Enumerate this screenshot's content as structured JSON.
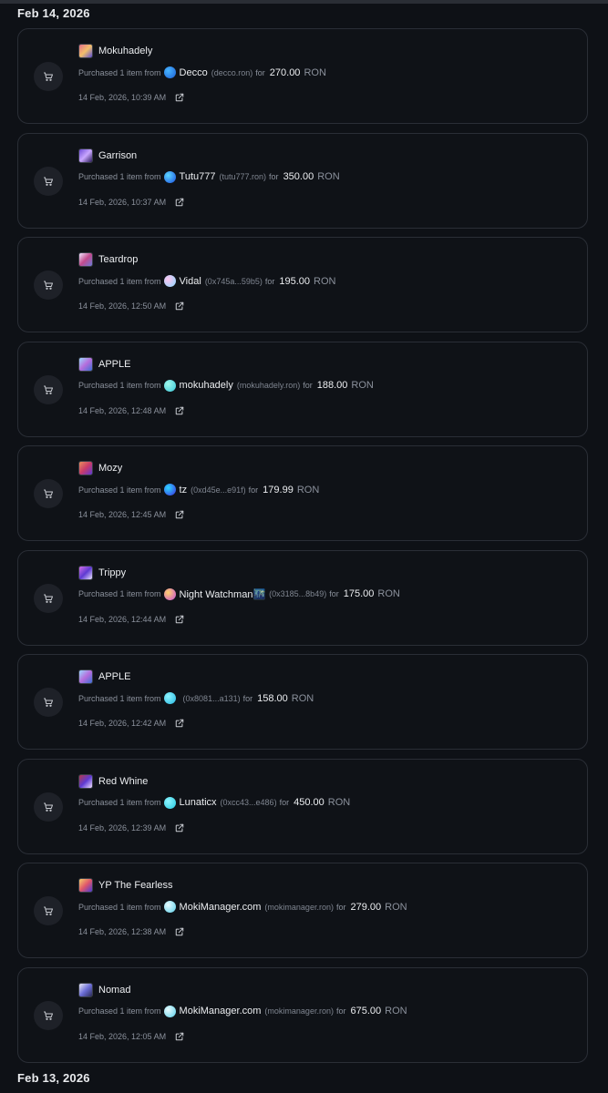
{
  "headers": {
    "first": "Feb 14, 2026",
    "second": "Feb 13, 2026"
  },
  "labels": {
    "purchased": "Purchased 1 item from",
    "for": "for"
  },
  "colors": {
    "background": "#0e1116",
    "card_border": "#2a2e36",
    "text": "#eceef1",
    "muted": "#8b919c"
  },
  "icons": {
    "action": "shopping-cart-icon",
    "link": "external-link-icon"
  },
  "items": [
    {
      "nft": "Mokuhadely",
      "seller": "Decco",
      "addr": "(decco.ron)",
      "price": "270.00",
      "currency": "RON",
      "time": "14 Feb, 2026, 10:39 AM"
    },
    {
      "nft": "Garrison",
      "seller": "Tutu777",
      "addr": "(tutu777.ron)",
      "price": "350.00",
      "currency": "RON",
      "time": "14 Feb, 2026, 10:37 AM"
    },
    {
      "nft": "Teardrop",
      "seller": "Vidal",
      "addr": "(0x745a...59b5)",
      "price": "195.00",
      "currency": "RON",
      "time": "14 Feb, 2026, 12:50 AM"
    },
    {
      "nft": "APPLE",
      "seller": "mokuhadely",
      "addr": "(mokuhadely.ron)",
      "price": "188.00",
      "currency": "RON",
      "time": "14 Feb, 2026, 12:48 AM"
    },
    {
      "nft": "Mozy",
      "seller": "tz",
      "addr": "(0xd45e...e91f)",
      "price": "179.99",
      "currency": "RON",
      "time": "14 Feb, 2026, 12:45 AM"
    },
    {
      "nft": "Trippy",
      "seller": "Night Watchman🌃",
      "addr": "(0x3185...8b49)",
      "price": "175.00",
      "currency": "RON",
      "time": "14 Feb, 2026, 12:44 AM"
    },
    {
      "nft": "APPLE",
      "seller": "",
      "addr": "(0x8081...a131)",
      "price": "158.00",
      "currency": "RON",
      "time": "14 Feb, 2026, 12:42 AM"
    },
    {
      "nft": "Red Whine",
      "seller": "Lunaticx",
      "addr": "(0xcc43...e486)",
      "price": "450.00",
      "currency": "RON",
      "time": "14 Feb, 2026, 12:39 AM"
    },
    {
      "nft": "YP The Fearless",
      "seller": "MokiManager.com",
      "addr": "(mokimanager.ron)",
      "price": "279.00",
      "currency": "RON",
      "time": "14 Feb, 2026, 12:38 AM"
    },
    {
      "nft": "Nomad",
      "seller": "MokiManager.com",
      "addr": "(mokimanager.ron)",
      "price": "675.00",
      "currency": "RON",
      "time": "14 Feb, 2026, 12:05 AM"
    }
  ]
}
